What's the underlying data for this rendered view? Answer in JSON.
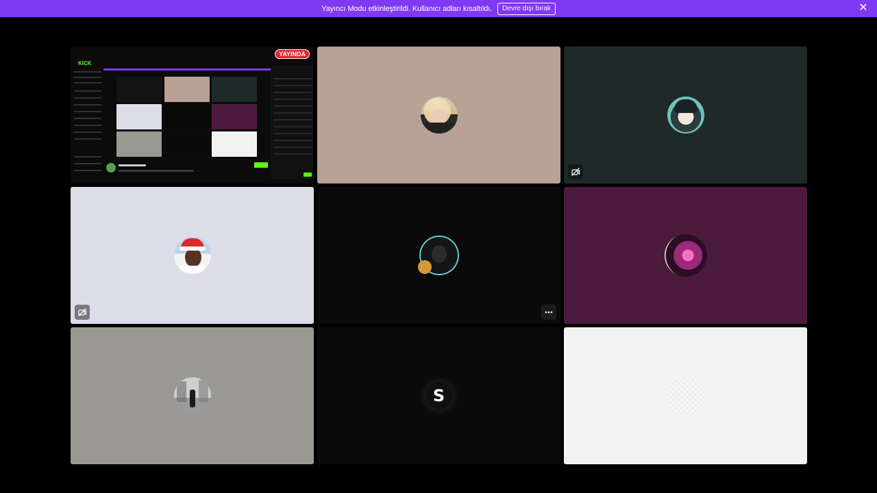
{
  "banner": {
    "message": "Yayıncı Modu etkinleştirildi. Kullanıcı adları kısaltıldı.",
    "disable_label": "Devre dışı bırak"
  },
  "share_tile": {
    "live_badge": "YAYINDA",
    "site_logo": "KICK"
  },
  "tiles": [
    {
      "kind": "screen-share",
      "bg": "#0b0b0b"
    },
    {
      "kind": "avatar",
      "bg": "#b9a197",
      "avatar": "blonde-person-photo"
    },
    {
      "kind": "avatar",
      "bg": "#1e2a28",
      "avatar": "anime-character",
      "overlay_icon": "camera-off-icon"
    },
    {
      "kind": "avatar",
      "bg": "#dddce9",
      "avatar": "santa-hat-person",
      "overlay_icon": "camera-off-icon"
    },
    {
      "kind": "avatar",
      "bg": "#0a0a0a",
      "avatar": "framed-dark-person",
      "overlay_icon": "more-icon"
    },
    {
      "kind": "avatar",
      "bg": "#4b1a3c",
      "avatar": "pink-anime-character"
    },
    {
      "kind": "avatar",
      "bg": "#999891",
      "avatar": "winter-walk-photo"
    },
    {
      "kind": "avatar",
      "bg": "#0a0a0a",
      "avatar": "letter-s-logo",
      "letter": "S"
    },
    {
      "kind": "avatar",
      "bg": "#f2f2f2",
      "avatar": "white-blank"
    }
  ]
}
